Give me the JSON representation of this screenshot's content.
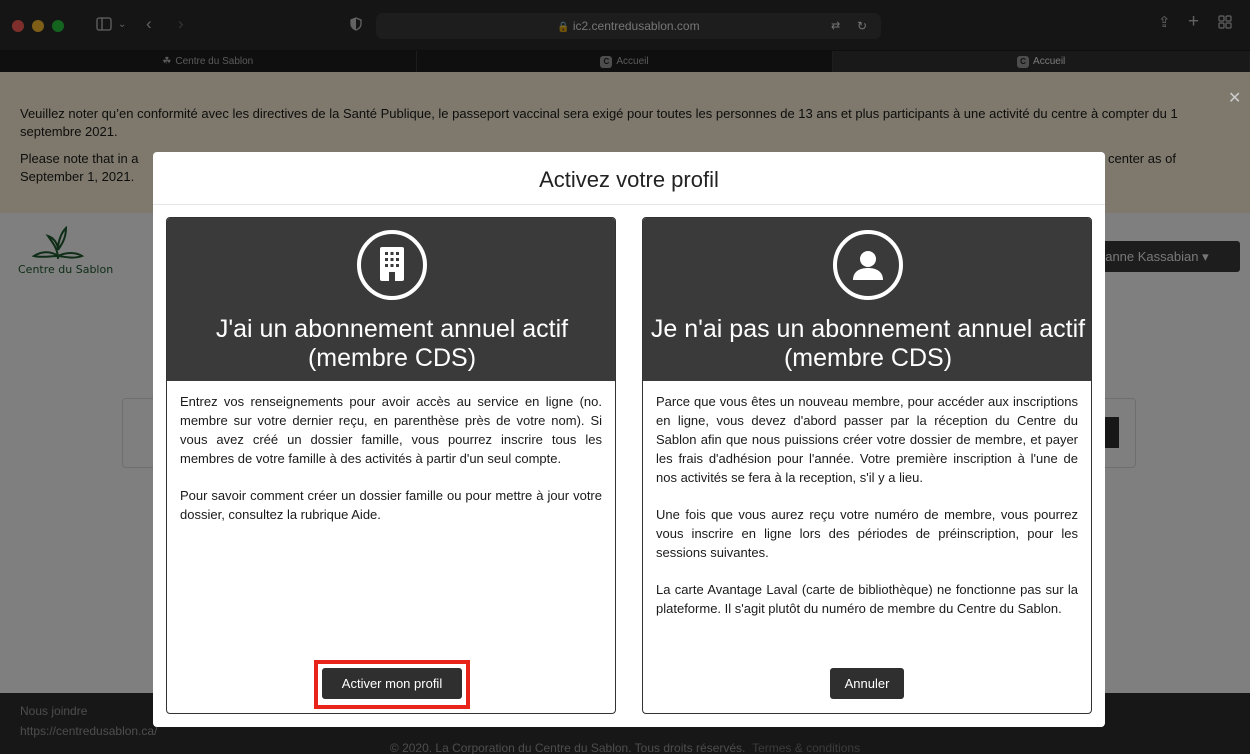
{
  "browser": {
    "url": "ic2.centredusablon.com",
    "tabs": [
      {
        "label": "Centre du Sablon"
      },
      {
        "label": "Accueil",
        "favicon": "C"
      },
      {
        "label": "Accueil",
        "favicon": "C"
      }
    ]
  },
  "notice": {
    "fr": "Veuillez noter qu’en conformité avec les directives de la Santé Publique, le passeport vaccinal sera exigé pour toutes les personnes de 13 ans et plus participants à une activité du centre à compter du 1 septembre 2021.",
    "en_start": "Please note that in a",
    "en_end": "center as of",
    "en_line2": "September 1, 2021."
  },
  "page": {
    "logo_text": "Centre du Sablon",
    "user_name": "rianne Kassabian ▾"
  },
  "footer": {
    "contact_label": "Nous joindre",
    "contact_url": "https://centredusablon.ca/",
    "copyright": "© 2020. La Corporation du Centre du Sablon. Tous droits réservés.",
    "terms": "Termes & conditions"
  },
  "modal": {
    "title": "Activez votre profil",
    "left_card": {
      "title": "J'ai un abonnement annuel actif (membre CDS)",
      "para1": "Entrez vos renseignements pour avoir accès au service en ligne (no. membre sur votre dernier reçu, en parenthèse près de votre nom). Si vous avez créé un dossier famille, vous pourrez inscrire tous les membres de votre famille à des activités à partir d'un seul compte.",
      "para2": "Pour savoir comment créer un dossier famille ou pour mettre à jour votre dossier, consultez la rubrique Aide.",
      "button": "Activer mon profil"
    },
    "right_card": {
      "title": "Je n'ai pas un abonnement annuel actif (membre CDS)",
      "para1": "Parce que vous êtes un nouveau membre, pour accéder aux inscriptions en ligne, vous devez d'abord passer par la réception du Centre du Sablon afin que nous puissions créer votre dossier de membre, et payer les frais d'adhésion pour l'année. Votre première inscription à l'une de nos activités se fera à la reception, s'il y a lieu.",
      "para2": "Une fois que vous aurez reçu votre numéro de membre, vous pourrez vous inscrire en ligne lors des périodes de préinscription, pour les sessions suivantes.",
      "para3": "La carte Avantage Laval (carte de bibliothèque) ne fonctionne pas sur la plateforme. Il s'agit plutôt du numéro de membre du Centre du Sablon.",
      "button": "Annuler"
    }
  },
  "colors": {
    "highlight": "#e8241a",
    "card_header": "#3a3a3a",
    "notice_bg": "#fdf3d8"
  }
}
